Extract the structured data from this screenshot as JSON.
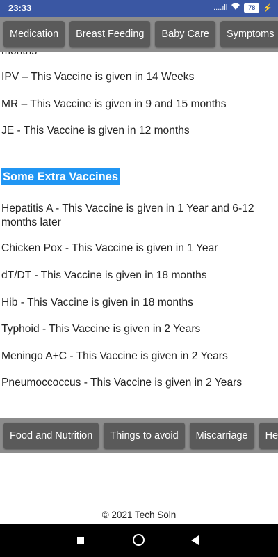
{
  "status": {
    "time": "23:33",
    "signal_text": "....ıll",
    "battery": "78",
    "icons": [
      "signal-icon",
      "wifi-icon",
      "battery-icon",
      "charging-icon"
    ]
  },
  "top_nav": [
    "Medication",
    "Breast Feeding",
    "Baby Care",
    "Symptoms"
  ],
  "content": {
    "partial_line": "months",
    "vaccines": [
      "IPV – This Vaccine is given in 14 Weeks",
      "MR – This Vaccine is given in 9 and 15 months",
      "JE - This Vaccine is given in 12 months"
    ],
    "extra_heading": "Some Extra Vaccines",
    "extra_vaccines": [
      "Hepatitis A - This Vaccine is given in 1 Year and 6-12 months later",
      "Chicken Pox - This Vaccine is given in 1 Year",
      "dT/DT - This Vaccine is given in 18 months",
      "Hib - This Vaccine is given in 18 months",
      "Typhoid - This Vaccine is given in 2 Years",
      "Meningo A+C - This Vaccine is given in 2 Years",
      "Pneumoccoccus - This Vaccine is given in 2 Years"
    ]
  },
  "bottom_nav": [
    "Food and Nutrition",
    "Things to avoid",
    "Miscarriage",
    "Healt"
  ],
  "footer": "© 2021 Tech Soln",
  "colors": {
    "status_bar": "#3a57a3",
    "nav_background": "#8c8c8c",
    "nav_button": "#5a5a5a",
    "heading_highlight": "#2196f3"
  }
}
